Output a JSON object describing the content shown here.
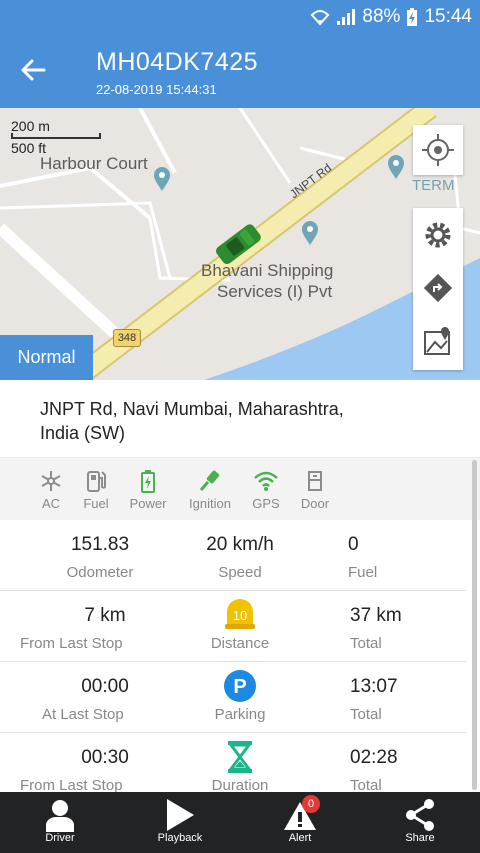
{
  "status_bar": {
    "battery": "88%",
    "time": "15:44"
  },
  "header": {
    "title": "MH04DK7425",
    "subtitle": "22-08-2019 15:44:31"
  },
  "map": {
    "scale_m": "200 m",
    "scale_ft": "500 ft",
    "places": [
      "Harbour Court",
      "EFC TERM",
      "Bhavani Shipping",
      "Services (I) Pvt"
    ],
    "road_name": "JNPT Rd",
    "highway": "348",
    "mode_label": "Normal"
  },
  "address": "JNPT Rd, Navi Mumbai, Maharashtra, India (SW)",
  "status_icons": [
    {
      "label": "AC",
      "icon": "snowflake-icon",
      "color": "#8c8c8c"
    },
    {
      "label": "Fuel",
      "icon": "fuel-pump-icon",
      "color": "#8c8c8c"
    },
    {
      "label": "Power",
      "icon": "battery-icon",
      "color": "#4caf50"
    },
    {
      "label": "Ignition",
      "icon": "key-icon",
      "color": "#4caf50"
    },
    {
      "label": "GPS",
      "icon": "wifi-icon",
      "color": "#4caf50"
    },
    {
      "label": "Door",
      "icon": "door-icon",
      "color": "#8c8c8c"
    }
  ],
  "stats": [
    [
      {
        "value": "151.83",
        "label": "Odometer"
      },
      {
        "value": "20 km/h",
        "label": "Speed"
      },
      {
        "value": "0",
        "label": "Fuel"
      }
    ],
    [
      {
        "value": "7 km",
        "label": "From Last Stop"
      },
      {
        "value": "10",
        "label": "Distance"
      },
      {
        "value": "37 km",
        "label": "Total"
      }
    ],
    [
      {
        "value": "00:00",
        "label": "At Last Stop"
      },
      {
        "value": "P",
        "label": "Parking"
      },
      {
        "value": "13:07",
        "label": "Total"
      }
    ],
    [
      {
        "value": "00:30",
        "label": "From Last Stop"
      },
      {
        "value": "",
        "label": "Duration"
      },
      {
        "value": "02:28",
        "label": "Total"
      }
    ]
  ],
  "bottom_nav": {
    "driver": "Driver",
    "playback": "Playback",
    "alert": "Alert",
    "alert_count": "0",
    "share": "Share"
  },
  "colors": {
    "primary": "#4a90d9",
    "active_green": "#4caf50",
    "distance_yellow": "#f2c200",
    "parking_blue": "#1e88e5",
    "duration_teal": "#1bb58a"
  }
}
